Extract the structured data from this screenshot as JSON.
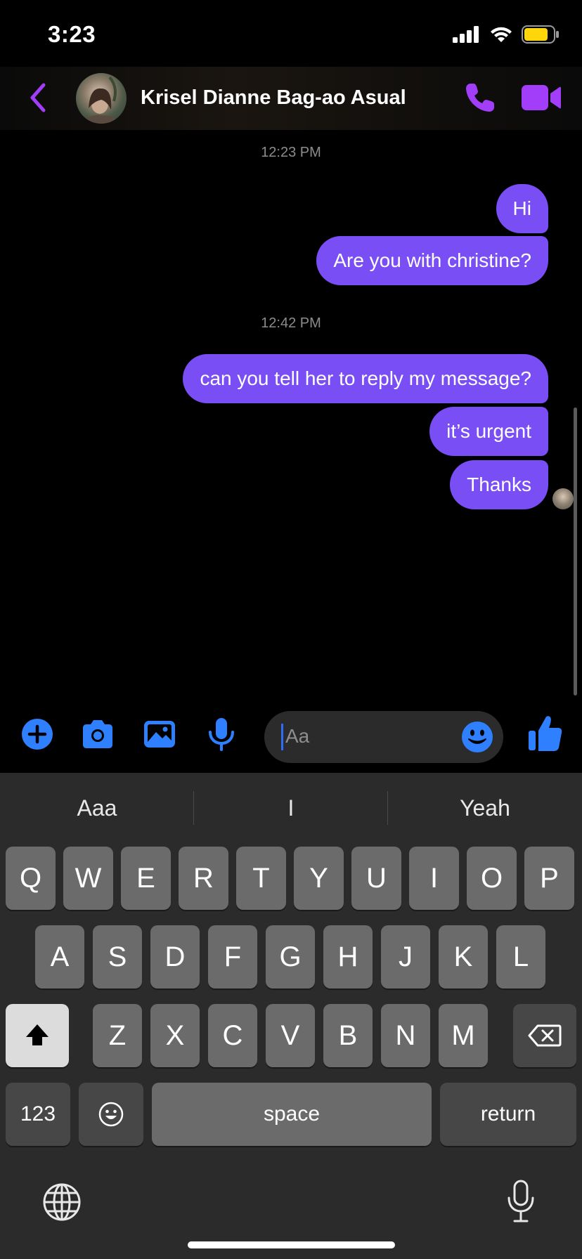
{
  "status_bar": {
    "time": "3:23"
  },
  "header": {
    "contact_name": "Krisel Dianne Bag-ao Asual"
  },
  "messages": [
    {
      "timestamp": "12:23 PM"
    },
    {
      "text": "Hi"
    },
    {
      "text": "Are you with christine?"
    },
    {
      "timestamp": "12:42 PM"
    },
    {
      "text": "can you tell her to reply my message?"
    },
    {
      "text": "it’s urgent"
    },
    {
      "text": "Thanks"
    }
  ],
  "composer": {
    "placeholder": "Aa"
  },
  "keyboard": {
    "suggestions": [
      "Aaa",
      "I",
      "Yeah"
    ],
    "row1": [
      "Q",
      "W",
      "E",
      "R",
      "T",
      "Y",
      "U",
      "I",
      "O",
      "P"
    ],
    "row2": [
      "A",
      "S",
      "D",
      "F",
      "G",
      "H",
      "J",
      "K",
      "L"
    ],
    "row3": [
      "Z",
      "X",
      "C",
      "V",
      "B",
      "N",
      "M"
    ],
    "numbers_key": "123",
    "space_key": "space",
    "return_key": "return"
  },
  "colors": {
    "accent": "#7a4ef5",
    "icon_purple": "#a23dfa",
    "icon_blue": "#2f80ff",
    "keyboard_bg": "#2b2b2b"
  }
}
